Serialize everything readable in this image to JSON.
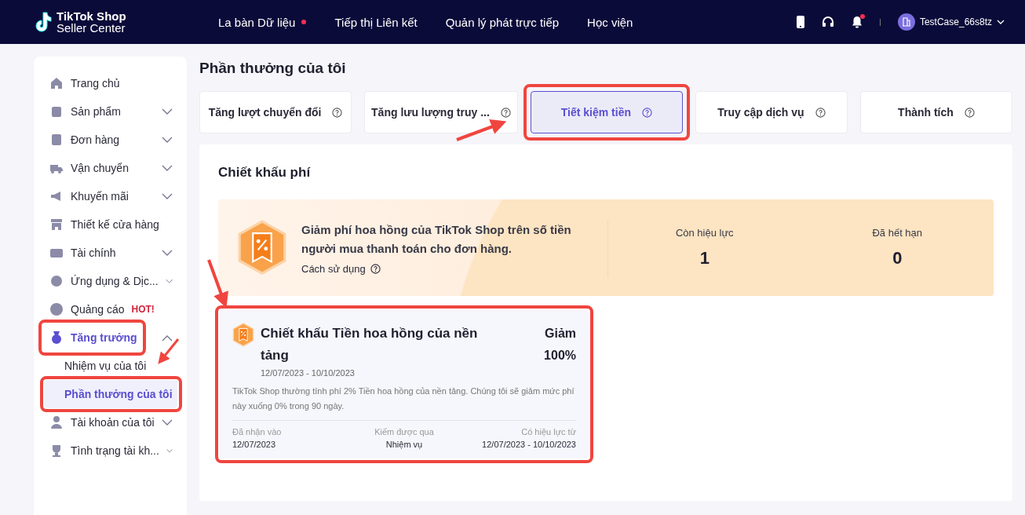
{
  "header": {
    "logo_line1": "TikTok Shop",
    "logo_line2": "Seller Center",
    "nav": [
      {
        "label": "La bàn Dữ liệu",
        "dot": true
      },
      {
        "label": "Tiếp thị Liên kết",
        "dot": false
      },
      {
        "label": "Quản lý phát trực tiếp",
        "dot": false
      },
      {
        "label": "Học viện",
        "dot": false
      }
    ],
    "notification_dot": true,
    "username": "TestCase_66s8tz"
  },
  "sidebar": {
    "items": [
      {
        "label": "Trang chủ",
        "selected": false
      },
      {
        "label": "Sản phẩm",
        "selected": false,
        "expanded": false
      },
      {
        "label": "Đơn hàng",
        "selected": false,
        "expanded": false
      },
      {
        "label": "Vận chuyển",
        "selected": false,
        "expanded": false
      },
      {
        "label": "Khuyến mãi",
        "selected": false,
        "expanded": false
      },
      {
        "label": "Thiết kế cửa hàng",
        "selected": false
      },
      {
        "label": "Tài chính",
        "selected": false,
        "expanded": false
      },
      {
        "label": "Ứng dụng & Dịc...",
        "selected": false,
        "expanded": false
      },
      {
        "label": "Quảng cáo",
        "selected": false,
        "badge": "HOT!"
      },
      {
        "label": "Tăng trưởng",
        "selected": true,
        "expanded": true,
        "highlighted": true,
        "children": [
          {
            "label": "Nhiệm vụ của tôi",
            "selected": false,
            "highlighted": false
          },
          {
            "label": "Phần thưởng của tôi",
            "selected": true,
            "highlighted": true
          }
        ]
      },
      {
        "label": "Tài khoản của tôi",
        "selected": false,
        "expanded": false
      },
      {
        "label": "Tình trạng tài kh...",
        "selected": false,
        "expanded": false
      }
    ]
  },
  "page_title": "Phần thưởng của tôi",
  "tabs": [
    {
      "label": "Tăng lượt chuyển đổi",
      "selected": false,
      "highlighted": false
    },
    {
      "label": "Tăng lưu lượng truy ...",
      "selected": false,
      "highlighted": false
    },
    {
      "label": "Tiết kiệm tiền",
      "selected": true,
      "highlighted": true
    },
    {
      "label": "Truy cập dịch vụ",
      "selected": false,
      "highlighted": false
    },
    {
      "label": "Thành tích",
      "selected": false,
      "highlighted": false
    }
  ],
  "section": {
    "title": "Chiết khấu phí",
    "banner": {
      "text": "Giảm phí hoa hồng của TikTok Shop trên số tiền người mua thanh toán cho đơn hàng.",
      "link": "Cách sử dụng",
      "stats": [
        {
          "label": "Còn hiệu lực",
          "value": "1"
        },
        {
          "label": "Đã hết hạn",
          "value": "0"
        }
      ]
    },
    "cards": [
      {
        "title": "Chiết khấu Tiền hoa hồng của nền tảng",
        "dates": "12/07/2023 - 10/10/2023",
        "discount_label": "Giảm",
        "discount_value": "100%",
        "highlighted": true,
        "description": "TikTok Shop thường tính phí 2% Tiền hoa hồng của nền tảng. Chúng tôi sẽ giảm mức phí này xuống 0% trong 90 ngày.",
        "fields": [
          {
            "label": "Đã nhận vào",
            "value": "12/07/2023"
          },
          {
            "label": "Kiếm được qua",
            "value": "Nhiệm vụ"
          },
          {
            "label": "Có hiệu lực từ",
            "value": "12/07/2023 - 10/10/2023"
          }
        ]
      }
    ]
  }
}
